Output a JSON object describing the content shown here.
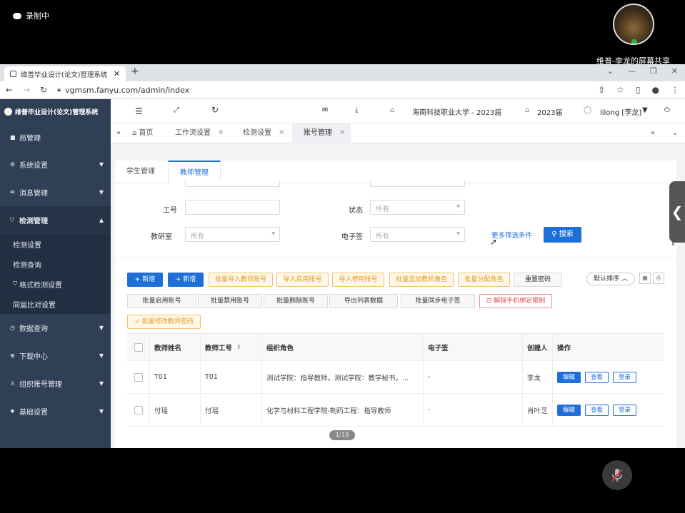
{
  "recording": {
    "label": "录制中"
  },
  "share": {
    "label": "维普-李龙的屏幕共享",
    "page_counter": "1/19"
  },
  "browser": {
    "tab_title": "维普毕业设计(论文)管理系统",
    "url": "vgmsm.fanyu.com/admin/index"
  },
  "sidebar": {
    "brand": "维普毕业设计(论文)管理系统",
    "items": [
      {
        "label": "局管理",
        "icon": "home-icon"
      },
      {
        "label": "系统设置",
        "icon": "gear-icon"
      },
      {
        "label": "消息管理",
        "icon": "message-icon"
      },
      {
        "label": "检测管理",
        "icon": "shield-icon"
      },
      {
        "label": "数据查询",
        "icon": "search-icon"
      },
      {
        "label": "下载中心",
        "icon": "download-icon"
      },
      {
        "label": "组织账号管理",
        "icon": "user-icon"
      },
      {
        "label": "基础设置",
        "icon": "settings-icon"
      }
    ],
    "subitems": [
      "检测设置",
      "检测查询",
      "格式检测设置",
      "同届比对设置"
    ]
  },
  "topbar": {
    "school": "海南科技职业大学 - 2023届",
    "year": "2023届",
    "user": "lilong [李龙]"
  },
  "page_tabs": [
    "首页",
    "工作流设置",
    "检测设置",
    "账号管理"
  ],
  "sub_tabs": [
    "学生管理",
    "教师管理"
  ],
  "filters": {
    "job_no_label": "工号",
    "status_label": "状态",
    "status_value": "所有",
    "dept_label": "教研室",
    "dept_value": "所有",
    "esign_label": "电子签",
    "esign_value": "所有",
    "more_label": "更多筛选条件",
    "search_label": "搜索"
  },
  "actions": {
    "add1": "+ 新增",
    "add2": "+ 新增",
    "import_teacher": "批量导入教师账号",
    "import_enable": "导入启用账号",
    "import_disable": "导入停用账号",
    "batch_add_role": "批量追加教师角色",
    "batch_assign_role": "批量分配角色",
    "reset_pwd": "重置密码",
    "sort": "默认排序 ︿",
    "batch_enable": "批量启用账号",
    "batch_disable": "批量禁用账号",
    "batch_delete": "批量删除账号",
    "export_list": "导出列表数据",
    "batch_sync_esign": "批量同步电子签",
    "unbind_phone": "解除手机绑定限制",
    "batch_modify_pwd": "批量修改教师密码"
  },
  "table": {
    "headers": [
      "教师姓名",
      "教师工号",
      "组织角色",
      "电子签",
      "创建人",
      "操作"
    ],
    "rows": [
      {
        "name": "T01",
        "job_no": "T01",
        "role": "测试学院：指导教师，测试学院：教学秘书，...",
        "esign": "-",
        "creator": "李龙"
      },
      {
        "name": "付瑶",
        "job_no": "付瑶",
        "role": "化学与材料工程学院-制药工程：指导教师",
        "esign": "-",
        "creator": "肖叶芝"
      }
    ],
    "op_edit": "编辑",
    "op_view": "查看",
    "op_login": "登录"
  }
}
